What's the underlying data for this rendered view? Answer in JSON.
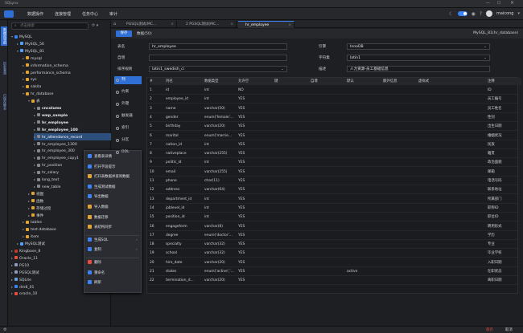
{
  "app": {
    "title": "SQLynx",
    "user": "maicong"
  },
  "menu": {
    "items": [
      "数据操作",
      "连接管理",
      "任务中心",
      "审计"
    ],
    "active_index": 0
  },
  "sidebar_tabs": [
    "数据库导航",
    "历史查询",
    "已保存脚本"
  ],
  "tree": {
    "search_placeholder": "点击搜索",
    "nodes": [
      {
        "label": "MySQL",
        "level": 0,
        "color": "#3b82f6",
        "expanded": true
      },
      {
        "label": "MySQL_56",
        "level": 1,
        "color": "#4da3ff"
      },
      {
        "label": "MySQL_81",
        "level": 1,
        "color": "#4da3ff",
        "expanded": true
      },
      {
        "label": "mysql",
        "level": 2,
        "color": "#e3a333"
      },
      {
        "label": "information_schema",
        "level": 2,
        "color": "#e3a333"
      },
      {
        "label": "performance_schema",
        "level": 2,
        "color": "#e3a333"
      },
      {
        "label": "sys",
        "level": 2,
        "color": "#e3a333"
      },
      {
        "label": "sakila",
        "level": 2,
        "color": "#e3a333"
      },
      {
        "label": "hr_database",
        "level": 2,
        "color": "#e3a333",
        "expanded": true
      },
      {
        "label": "表",
        "level": 3,
        "color": "#e3a333",
        "expanded": true
      },
      {
        "label": "cncolums",
        "level": 4,
        "color": "#888888",
        "bold": true
      },
      {
        "label": "emp_sample",
        "level": 4,
        "color": "#888888",
        "bold": true
      },
      {
        "label": "hr_employee",
        "level": 4,
        "color": "#888888",
        "bold": true
      },
      {
        "label": "hr_employee_100",
        "level": 4,
        "color": "#888888",
        "bold": true
      },
      {
        "label": "hr_attendance_record",
        "level": 4,
        "color": "#888888",
        "selected": true
      },
      {
        "label": "hr_employee_1300",
        "level": 4,
        "color": "#888888"
      },
      {
        "label": "hr_employee_300",
        "level": 4,
        "color": "#888888"
      },
      {
        "label": "hr_employee_copy1",
        "level": 4,
        "color": "#888888"
      },
      {
        "label": "hr_position",
        "level": 4,
        "color": "#888888"
      },
      {
        "label": "hr_salary",
        "level": 4,
        "color": "#888888"
      },
      {
        "label": "long_text",
        "level": 4,
        "color": "#888888"
      },
      {
        "label": "new_table",
        "level": 4,
        "color": "#888888"
      },
      {
        "label": "视图",
        "level": 3,
        "color": "#e3a333"
      },
      {
        "label": "函数",
        "level": 3,
        "color": "#e3a333"
      },
      {
        "label": "存储过程",
        "level": 3,
        "color": "#e3a333"
      },
      {
        "label": "事件",
        "level": 3,
        "color": "#e3a333"
      },
      {
        "label": "tables",
        "level": 2,
        "color": "#e3a333"
      },
      {
        "label": "test-database",
        "level": 2,
        "color": "#e3a333"
      },
      {
        "label": "item",
        "level": 2,
        "color": "#e3a333"
      },
      {
        "label": "MySQL测试",
        "level": 1,
        "color": "#4da3ff"
      },
      {
        "label": "Kingbase_8",
        "level": 0,
        "color": "#c0392b"
      },
      {
        "label": "Oracle_11",
        "level": 0,
        "color": "#e74c3c"
      },
      {
        "label": "PG10",
        "level": 0,
        "color": "#8e9cc2"
      },
      {
        "label": "PGSQL测试",
        "level": 0,
        "color": "#8e9cc2"
      },
      {
        "label": "SQLite",
        "level": 0,
        "color": "#6aa0d8"
      },
      {
        "label": "dm8_01",
        "level": 0,
        "color": "#3b82f6"
      },
      {
        "label": "oracle_10",
        "level": 0,
        "color": "#e74c3c"
      }
    ]
  },
  "context_menu": {
    "items": [
      {
        "label": "查看表详情",
        "color": "#3b82f6"
      },
      {
        "label": "打开字段提示",
        "color": "#3b82f6"
      },
      {
        "label": "打开表数据并查询数据",
        "color": "#e3a333"
      },
      {
        "label": "生成测试数据",
        "color": "#3b82f6"
      },
      {
        "label": "导出数据",
        "color": "#3b82f6"
      },
      {
        "label": "导入数据",
        "color": "#e3a333"
      },
      {
        "label": "数据迁移",
        "color": "#e3a333"
      },
      {
        "label": "表结构同步",
        "color": "#e3a333"
      },
      {
        "label": "生成SQL",
        "color": "#3b82f6",
        "submenu": true
      },
      {
        "label": "复制",
        "color": "#3b82f6",
        "submenu": true
      },
      {
        "label": "删除",
        "color": "#e74c3c"
      },
      {
        "label": "重命名",
        "color": "#3b82f6"
      },
      {
        "label": "刷新",
        "color": "#3b82f6"
      }
    ]
  },
  "tabs": [
    {
      "label": "PGSQL测试(MC...",
      "active": false
    },
    {
      "label": "2 PGSQL测试(MC...",
      "active": false
    },
    {
      "label": "hr_employee",
      "active": true
    }
  ],
  "toolbar": {
    "save_label": "保存",
    "subtitle": "数据(50)",
    "connection": "MySQL_81(hr_database)"
  },
  "form": {
    "table_name_label": "表名",
    "table_name": "hr_employee",
    "engine_label": "引擎",
    "engine": "InnoDB",
    "charset_label": "字符集",
    "charset": "latin1",
    "auto_label": "自增",
    "auto_value": "",
    "collation_label": "排序规则",
    "collation": "latin1_swedish_ci",
    "comment_label": "描述",
    "comment": "人力资源-员工基础信息"
  },
  "left_tabs": [
    {
      "label": "列",
      "active": true
    },
    {
      "label": "约束"
    },
    {
      "label": "外键"
    },
    {
      "label": "触发器"
    },
    {
      "label": "索引"
    },
    {
      "label": "分区"
    },
    {
      "label": "DDL"
    }
  ],
  "columns": {
    "headers": [
      "#",
      "列名",
      "数据类型",
      "允许空",
      "键",
      "自增",
      "默认",
      "额外信息",
      "虚拟式",
      "注释"
    ],
    "rows": [
      [
        "1",
        "id",
        "int",
        "NO",
        "",
        "",
        "",
        "",
        "",
        "ID"
      ],
      [
        "2",
        "employee_id",
        "int",
        "YES",
        "",
        "",
        "",
        "",
        "",
        "员工编号"
      ],
      [
        "3",
        "name",
        "varchar(50)",
        "YES",
        "",
        "",
        "",
        "",
        "",
        "员工姓名"
      ],
      [
        "4",
        "gender",
        "enum('female'...",
        "YES",
        "",
        "",
        "",
        "",
        "",
        "性别"
      ],
      [
        "5",
        "birthday",
        "varchar(20)",
        "YES",
        "",
        "",
        "",
        "",
        "",
        "出生日期"
      ],
      [
        "6",
        "marital",
        "enum('marrie...",
        "YES",
        "",
        "",
        "",
        "",
        "",
        "婚姻状况"
      ],
      [
        "7",
        "nation_id",
        "int",
        "YES",
        "",
        "",
        "",
        "",
        "",
        "民族"
      ],
      [
        "8",
        "nativeplace",
        "varchar(255)",
        "YES",
        "",
        "",
        "",
        "",
        "",
        "籍贯"
      ],
      [
        "9",
        "politic_id",
        "int",
        "YES",
        "",
        "",
        "",
        "",
        "",
        "政治面貌"
      ],
      [
        "10",
        "email",
        "varchar(255)",
        "YES",
        "",
        "",
        "",
        "",
        "",
        "邮箱"
      ],
      [
        "11",
        "phone",
        "char(11)",
        "YES",
        "",
        "",
        "",
        "",
        "",
        "电话号码"
      ],
      [
        "12",
        "address",
        "varchar(64)",
        "YES",
        "",
        "",
        "",
        "",
        "",
        "联系地址"
      ],
      [
        "13",
        "department_id",
        "int",
        "YES",
        "",
        "",
        "",
        "",
        "",
        "所属部门"
      ],
      [
        "14",
        "joblevel_id",
        "int",
        "YES",
        "",
        "",
        "",
        "",
        "",
        "职称ID"
      ],
      [
        "15",
        "position_id",
        "int",
        "YES",
        "",
        "",
        "",
        "",
        "",
        "职位ID"
      ],
      [
        "16",
        "engageform",
        "varchar(8)",
        "YES",
        "",
        "",
        "",
        "",
        "",
        "聘用形式"
      ],
      [
        "17",
        "degree",
        "enum('doctor'...",
        "YES",
        "",
        "",
        "",
        "",
        "",
        "学历"
      ],
      [
        "18",
        "specialty",
        "varchar(32)",
        "YES",
        "",
        "",
        "",
        "",
        "",
        "专业"
      ],
      [
        "19",
        "school",
        "varchar(32)",
        "YES",
        "",
        "",
        "",
        "",
        "",
        "毕业学校"
      ],
      [
        "20",
        "hire_date",
        "varchar(20)",
        "YES",
        "",
        "",
        "",
        "",
        "",
        "入职日期"
      ],
      [
        "21",
        "states",
        "enum('active','...",
        "YES",
        "",
        "",
        "active",
        "",
        "",
        "在职状态"
      ],
      [
        "22",
        "termination_d...",
        "varchar(20)",
        "YES",
        "",
        "",
        "",
        "",
        "",
        "离职日期"
      ]
    ]
  },
  "status": {
    "save": "保存",
    "cancel": "取消"
  }
}
